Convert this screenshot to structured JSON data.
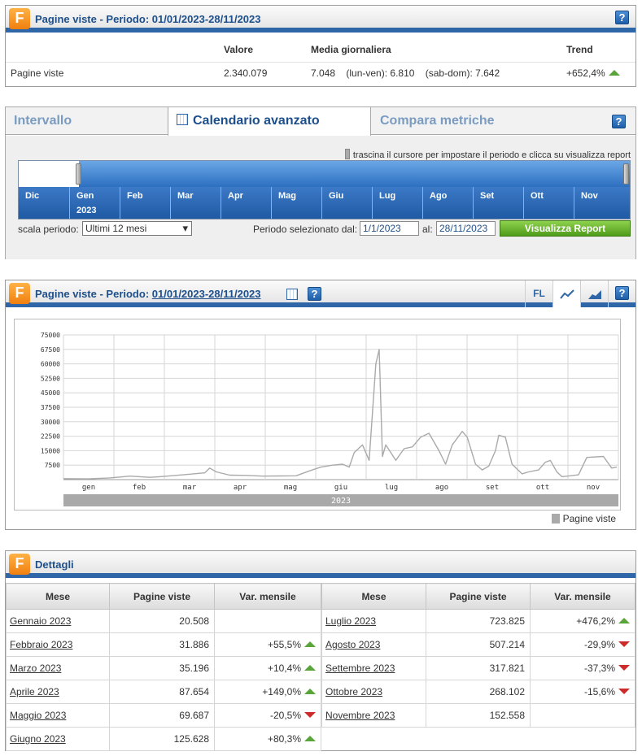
{
  "summary": {
    "title": "Pagine viste - Periodo: 01/01/2023-28/11/2023",
    "headers": {
      "valore": "Valore",
      "media": "Media giornaliera",
      "trend": "Trend"
    },
    "row": {
      "label": "Pagine viste",
      "valore": "2.340.079",
      "media_total": "7.048",
      "media_weekday": "(lun-ven): 6.810",
      "media_weekend": "(sab-dom): 7.642",
      "trend": "+652,4%"
    }
  },
  "calendar": {
    "tabs": [
      "Intervallo",
      "Calendario avanzato",
      "Compara metriche"
    ],
    "active_tab": "Calendario avanzato",
    "hint": "trascina il cursore per impostare il periodo e clicca su visualizza report",
    "months": [
      "Dic",
      "Gen",
      "Feb",
      "Mar",
      "Apr",
      "Mag",
      "Giu",
      "Lug",
      "Ago",
      "Set",
      "Ott",
      "Nov"
    ],
    "year_label": "2023",
    "scale_label": "scala periodo:",
    "scale_value": "Ultimi 12 mesi",
    "period_label": "Periodo selezionato dal:",
    "from": "1/1/2023",
    "to_label": "al:",
    "to": "28/11/2023",
    "button": "Visualizza Report"
  },
  "chart_panel": {
    "title_prefix": "Pagine viste - Periodo:",
    "title_period": "01/01/2023-28/11/2023",
    "fl_label": "FL",
    "legend": "Pagine viste"
  },
  "chart_data": {
    "type": "area",
    "ylim": [
      0,
      75000
    ],
    "yticks": [
      "75000",
      "67500",
      "60000",
      "52500",
      "45000",
      "37500",
      "30000",
      "22500",
      "15000",
      "7500"
    ],
    "xticks": [
      "gen",
      "feb",
      "mar",
      "apr",
      "mag",
      "giu",
      "lug",
      "ago",
      "set",
      "ott",
      "nov"
    ],
    "year_band": "2023",
    "series": [
      {
        "name": "Pagine viste",
        "color": "#aaaaaa",
        "x_days": [
          0,
          15,
          28,
          40,
          52,
          58,
          72,
          85,
          88,
          92,
          100,
          110,
          120,
          130,
          140,
          148,
          155,
          162,
          168,
          172,
          175,
          180,
          184,
          188,
          190,
          192,
          194,
          197,
          200,
          205,
          210,
          215,
          220,
          226,
          230,
          234,
          240,
          243,
          248,
          252,
          256,
          260,
          262,
          266,
          270,
          276,
          280,
          286,
          290,
          293,
          297,
          300,
          305,
          310,
          315,
          325,
          330,
          333
        ],
        "values": [
          500,
          400,
          900,
          1800,
          1200,
          1500,
          2500,
          3500,
          6000,
          4000,
          2300,
          2200,
          1800,
          1900,
          2000,
          4500,
          6500,
          7500,
          8000,
          6500,
          14000,
          18000,
          10000,
          60000,
          67500,
          12000,
          18000,
          14000,
          10000,
          16000,
          17000,
          22000,
          24000,
          15000,
          8000,
          18000,
          25000,
          22000,
          8000,
          5000,
          7000,
          15000,
          23000,
          22000,
          8000,
          3000,
          4000,
          5000,
          9000,
          10000,
          4000,
          1500,
          2000,
          2500,
          11500,
          12000,
          6000,
          6500
        ]
      }
    ]
  },
  "details": {
    "title": "Dettagli",
    "headers": [
      "Mese",
      "Pagine viste",
      "Var. mensile"
    ],
    "left": [
      {
        "mese": "Gennaio 2023",
        "pv": "20.508",
        "var": "",
        "dir": ""
      },
      {
        "mese": "Febbraio 2023",
        "pv": "31.886",
        "var": "+55,5%",
        "dir": "up"
      },
      {
        "mese": "Marzo 2023",
        "pv": "35.196",
        "var": "+10,4%",
        "dir": "up"
      },
      {
        "mese": "Aprile 2023",
        "pv": "87.654",
        "var": "+149,0%",
        "dir": "up"
      },
      {
        "mese": "Maggio 2023",
        "pv": "69.687",
        "var": "-20,5%",
        "dir": "down"
      },
      {
        "mese": "Giugno 2023",
        "pv": "125.628",
        "var": "+80,3%",
        "dir": "up"
      }
    ],
    "right": [
      {
        "mese": "Luglio 2023",
        "pv": "723.825",
        "var": "+476,2%",
        "dir": "up"
      },
      {
        "mese": "Agosto 2023",
        "pv": "507.214",
        "var": "-29,9%",
        "dir": "down"
      },
      {
        "mese": "Settembre 2023",
        "pv": "317.821",
        "var": "-37,3%",
        "dir": "down"
      },
      {
        "mese": "Ottobre 2023",
        "pv": "268.102",
        "var": "-15,6%",
        "dir": "down"
      },
      {
        "mese": "Novembre 2023",
        "pv": "152.558",
        "var": "",
        "dir": ""
      }
    ]
  },
  "colors": {
    "accent": "#2e66a8",
    "title": "#1d4f8b",
    "up": "#59a53a",
    "down": "#cc2b2b",
    "button": "#6cb832"
  }
}
